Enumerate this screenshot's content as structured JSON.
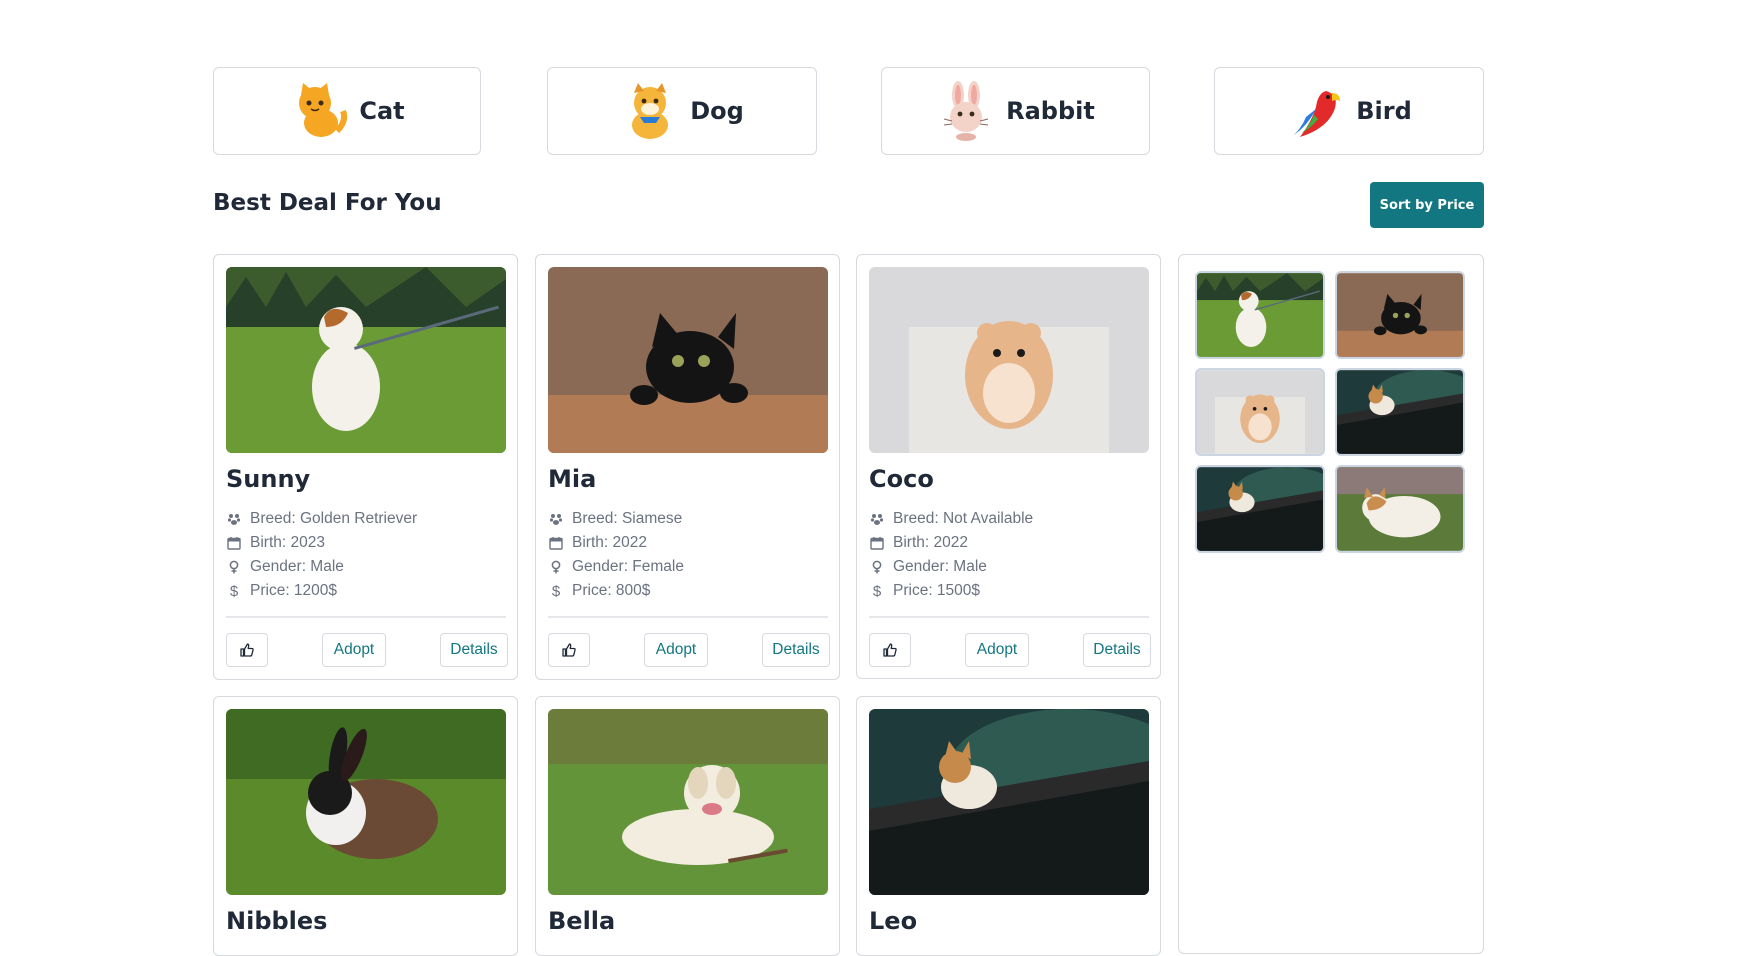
{
  "categories": [
    {
      "label": "Cat",
      "icon": "cat-face-icon"
    },
    {
      "label": "Dog",
      "icon": "dog-face-icon"
    },
    {
      "label": "Rabbit",
      "icon": "rabbit-face-icon"
    },
    {
      "label": "Bird",
      "icon": "parrot-icon"
    }
  ],
  "section": {
    "title": "Best Deal For You",
    "sort_label": "Sort by Price"
  },
  "pets": [
    {
      "name": "Sunny",
      "breed": "Breed: Golden Retriever",
      "birth": "Birth: 2023",
      "gender": "Gender: Male",
      "price": "Price: 1200$",
      "photo": "jack-russell-on-grass"
    },
    {
      "name": "Mia",
      "breed": "Breed: Siamese",
      "birth": "Birth: 2022",
      "gender": "Gender: Female",
      "price": "Price: 800$",
      "photo": "black-cat-on-table"
    },
    {
      "name": "Coco",
      "breed": "Breed: Not Available",
      "birth": "Birth: 2022",
      "gender": "Gender: Male",
      "price": "Price: 1500$",
      "photo": "hamster"
    },
    {
      "name": "Nibbles",
      "photo": "rabbit-on-grass"
    },
    {
      "name": "Bella",
      "photo": "labrador-on-grass"
    },
    {
      "name": "Leo",
      "photo": "cat-on-fence"
    }
  ],
  "actions": {
    "like_icon": "thumbs-up-icon",
    "adopt_label": "Adopt",
    "details_label": "Details"
  },
  "icons": {
    "breed": "paw-icon",
    "birth": "calendar-icon",
    "gender": "gender-icon",
    "price": "dollar-icon"
  },
  "colors": {
    "accent": "#127780",
    "text": "#1f2937",
    "muted": "#6b7280",
    "border": "#d6d9dd"
  }
}
